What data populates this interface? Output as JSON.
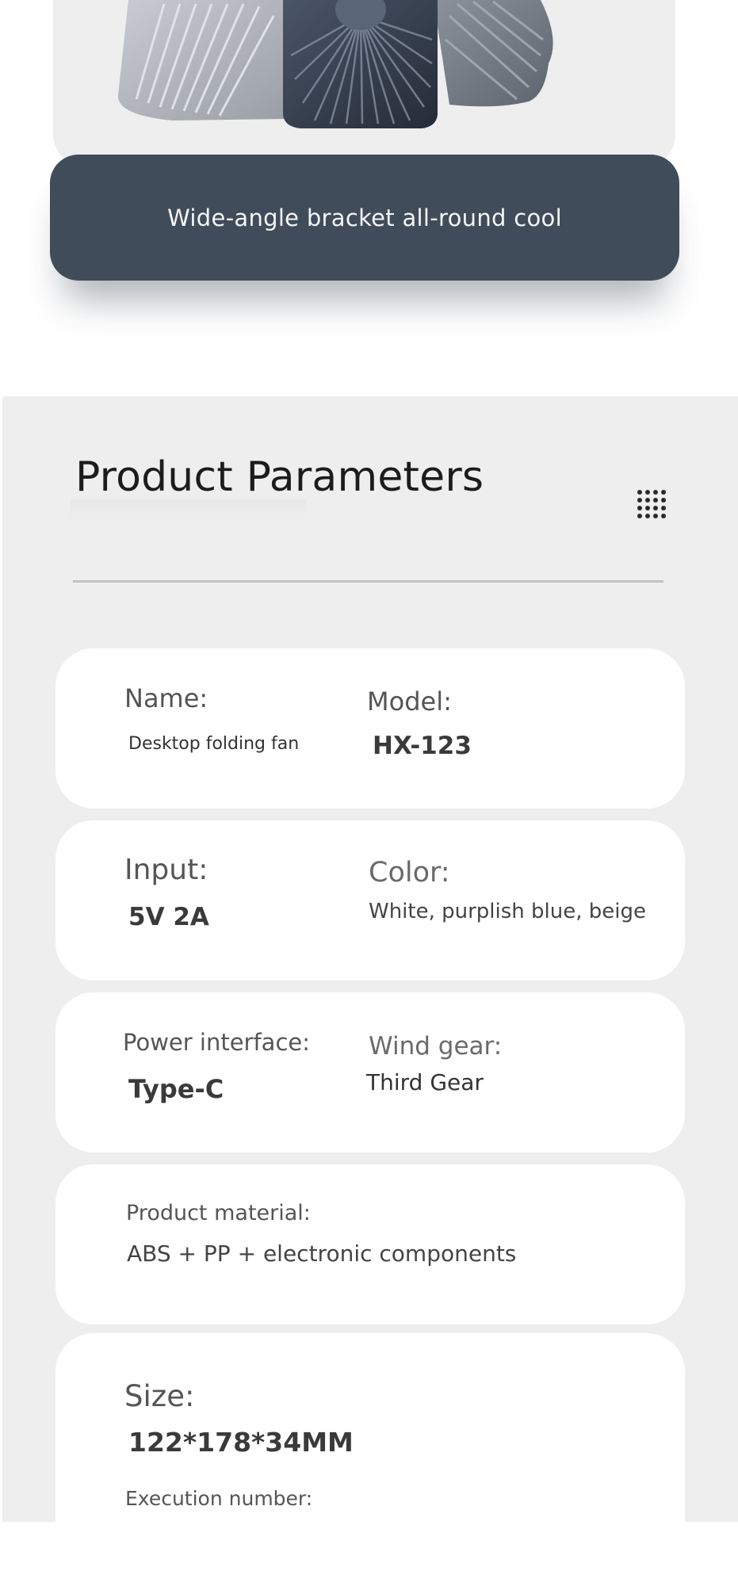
{
  "banner": {
    "text": "Wide-angle bracket all-round cool"
  },
  "parameters": {
    "title": "Product Parameters",
    "items": {
      "name_label": "Name:",
      "name_value": "Desktop folding fan",
      "model_label": "Model:",
      "model_value": "HX-123",
      "input_label": "Input:",
      "input_value": "5V 2A",
      "color_label": "Color:",
      "color_value": "White, purplish blue, beige",
      "power_label": "Power interface:",
      "power_value": "Type-C",
      "wind_label": "Wind gear:",
      "wind_value": "Third Gear",
      "material_label": "Product material:",
      "material_value": "ABS + PP + electronic components",
      "size_label": "Size:",
      "size_value": "122*178*34MM",
      "execution_label": "Execution number:"
    }
  },
  "icons": {
    "product": "folding-fan-image",
    "grid": "dot-grid-icon"
  }
}
